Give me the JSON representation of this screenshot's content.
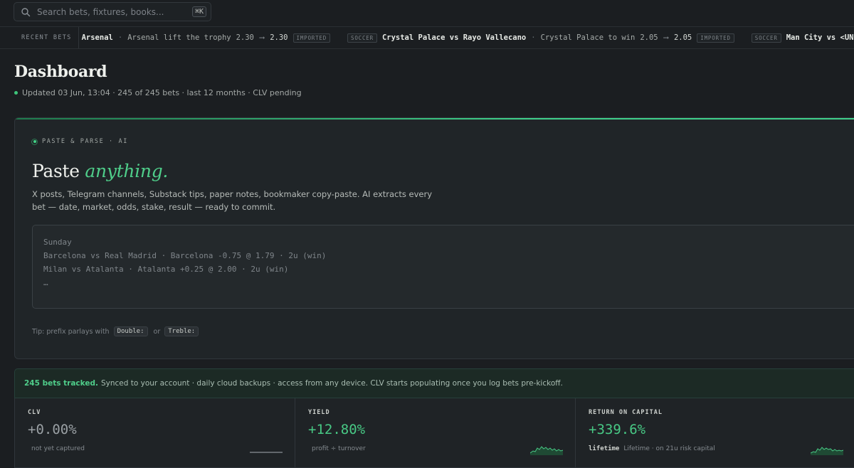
{
  "search": {
    "placeholder": "Search bets, fixtures, books...",
    "shortcut": "⌘K"
  },
  "ticker": {
    "label": "RECENT BETS",
    "items": [
      {
        "sport": "",
        "match": "Arsenal",
        "selection": "Arsenal lift the trophy",
        "odds_from": "2.30",
        "odds_to": "2.30",
        "status": "IMPORTED"
      },
      {
        "sport": "SOCCER",
        "match": "Crystal Palace vs Rayo Vallecano",
        "selection": "Crystal Palace to win",
        "odds_from": "2.05",
        "odds_to": "2.05",
        "status": "IMPORTED"
      },
      {
        "sport": "SOCCER",
        "match": "Man City vs <UNKNOWN"
      }
    ]
  },
  "header": {
    "title": "Dashboard",
    "status_line": "Updated 03 Jun, 13:04 · 245 of 245 bets · last 12 months · CLV pending"
  },
  "paste": {
    "eyebrow": "PASTE & PARSE · AI",
    "headline_plain": "Paste ",
    "headline_emph": "anything.",
    "description": "X posts, Telegram channels, Substack tips, paper notes, bookmaker copy-paste. AI extracts every bet — date, market, odds, stake, result — ready to commit.",
    "placeholder_lines": [
      "Sunday",
      "Barcelona vs Real Madrid · Barcelona -0.75 @ 1.79 · 2u (win)",
      "Milan vs Atalanta · Atalanta +0.25 @ 2.00 · 2u (win)",
      "…"
    ],
    "tip_prefix": "Tip: prefix parlays with",
    "tip_code_1": "Double:",
    "tip_or": "or",
    "tip_code_2": "Treble:"
  },
  "synced": {
    "strong": "245 bets tracked.",
    "text": "Synced to your account · daily cloud backups · access from any device. CLV starts populating once you log bets pre-kickoff."
  },
  "stats": [
    {
      "label": "CLV",
      "value": "+0.00%",
      "sub_bold": "",
      "sub": "not yet captured",
      "positive": false
    },
    {
      "label": "YIELD",
      "value": "+12.80%",
      "sub_bold": "",
      "sub": "profit ÷ turnover",
      "positive": true
    },
    {
      "label": "RETURN ON CAPITAL",
      "value": "+339.6%",
      "sub_bold": "lifetime",
      "sub": "Lifetime · on 21u risk capital",
      "positive": true
    }
  ],
  "colors": {
    "accent": "#4fce8a",
    "background": "#1b1e21",
    "card": "#202528"
  }
}
